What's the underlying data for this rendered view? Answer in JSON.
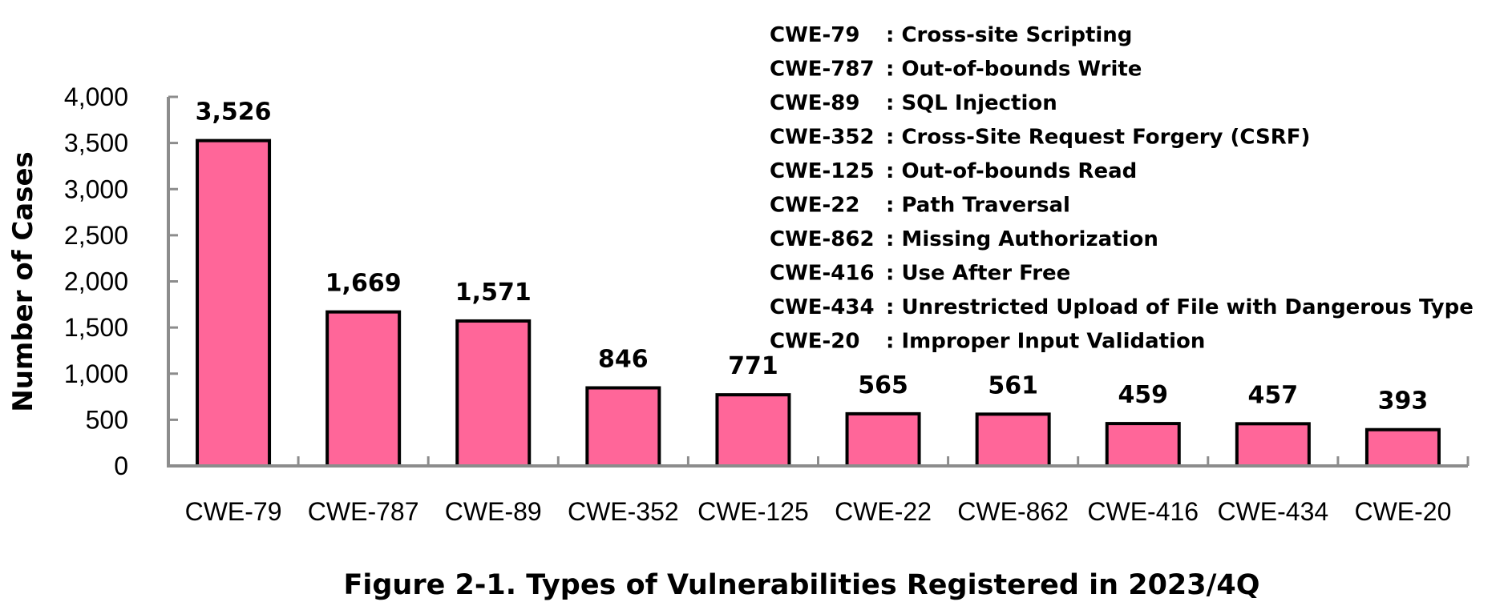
{
  "chart_data": {
    "type": "bar",
    "title": "Figure 2-1. Types of Vulnerabilities Registered in 2023/4Q",
    "xlabel": "",
    "ylabel": "Number of Cases",
    "ylim": [
      0,
      4000
    ],
    "yticks": [
      0,
      500,
      1000,
      1500,
      2000,
      2500,
      3000,
      3500,
      4000
    ],
    "ytick_labels": [
      "0",
      "500",
      "1,000",
      "1,500",
      "2,000",
      "2,500",
      "3,000",
      "3,500",
      "4,000"
    ],
    "categories": [
      "CWE-79",
      "CWE-787",
      "CWE-89",
      "CWE-352",
      "CWE-125",
      "CWE-22",
      "CWE-862",
      "CWE-416",
      "CWE-434",
      "CWE-20"
    ],
    "values": [
      3526,
      1669,
      1571,
      846,
      771,
      565,
      561,
      459,
      457,
      393
    ],
    "data_labels": [
      "3,526",
      "1,669",
      "1,571",
      "846",
      "771",
      "565",
      "561",
      "459",
      "457",
      "393"
    ],
    "bar_color": "#FF6699",
    "bar_edge_color": "#000000",
    "axis_color": "#8C8C8C",
    "grid": false,
    "legend_position": "top-right",
    "legend": [
      {
        "code": "CWE-79",
        "desc": ": Cross-site Scripting"
      },
      {
        "code": "CWE-787",
        "desc": ": Out-of-bounds Write"
      },
      {
        "code": "CWE-89",
        "desc": ": SQL Injection"
      },
      {
        "code": "CWE-352",
        "desc": ": Cross-Site Request Forgery (CSRF)"
      },
      {
        "code": "CWE-125",
        "desc": ": Out-of-bounds Read"
      },
      {
        "code": "CWE-22",
        "desc": ": Path Traversal"
      },
      {
        "code": "CWE-862",
        "desc": ": Missing Authorization"
      },
      {
        "code": "CWE-416",
        "desc": ": Use After Free"
      },
      {
        "code": "CWE-434",
        "desc": ": Unrestricted Upload of File with Dangerous Type"
      },
      {
        "code": "CWE-20",
        "desc": ": Improper Input Validation"
      }
    ]
  }
}
